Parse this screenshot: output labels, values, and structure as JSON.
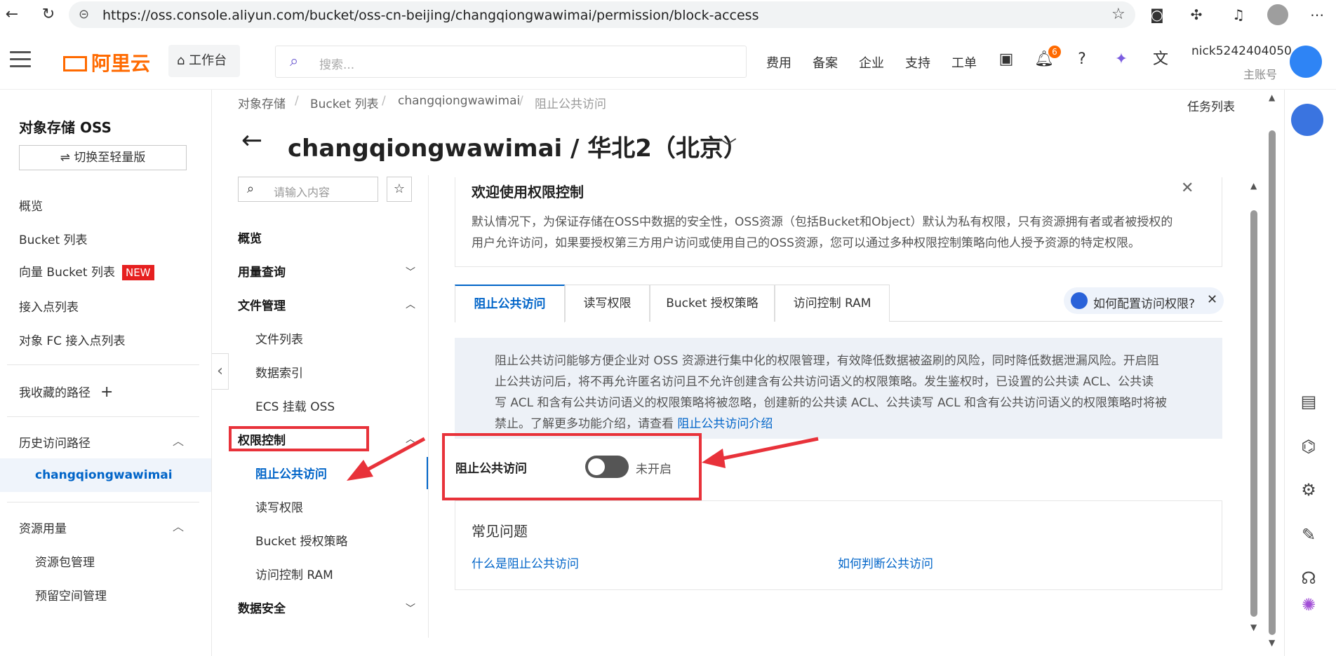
{
  "browser": {
    "url": "https://oss.console.aliyun.com/bucket/oss-cn-beijing/changqiongwawimai/permission/block-access"
  },
  "header": {
    "logo": "阿里云",
    "workbench": "工作台",
    "search_placeholder": "搜索...",
    "links": [
      "费用",
      "备案",
      "企业",
      "支持",
      "工单"
    ],
    "notification_count": "6",
    "username": "nick5242404050",
    "account_type": "主账号"
  },
  "left_nav": {
    "title": "对象存储 OSS",
    "switch_button": "⇌ 切换至轻量版",
    "items": [
      "概览",
      "Bucket 列表",
      "向量 Bucket 列表",
      "接入点列表",
      "对象 FC 接入点列表"
    ],
    "new_badge": "NEW",
    "favorites": "我收藏的路径",
    "history_title": "历史访问路径",
    "history_item": "changqiongwawimai",
    "resource_title": "资源用量",
    "resource_items": [
      "资源包管理",
      "预留空间管理"
    ]
  },
  "breadcrumb": [
    "对象存储",
    "Bucket 列表",
    "changqiongwawimai",
    "阻止公共访问"
  ],
  "task_list": "任务列表",
  "page_title": "changqiongwawimai / 华北2（北京）",
  "sub_nav": {
    "search_placeholder": "请输入内容",
    "groups": {
      "overview": "概览",
      "usage": "用量查询",
      "files": "文件管理",
      "permission": "权限控制",
      "data_security": "数据安全"
    },
    "file_items": [
      "文件列表",
      "数据索引",
      "ECS 挂载 OSS"
    ],
    "permission_items": [
      "阻止公共访问",
      "读写权限",
      "Bucket 授权策略",
      "访问控制 RAM"
    ]
  },
  "welcome": {
    "title": "欢迎使用权限控制",
    "lines": [
      "默认情况下，为保证存储在OSS中数据的安全性，OSS资源（包括Bucket和Object）默认为私有权限，只有资源拥有者或者被授权的",
      "用户允许访问，如果要授权第三方用户访问或使用自己的OSS资源，您可以通过多种权限控制策略向他人授予资源的特定权限。"
    ]
  },
  "tabs": [
    "阻止公共访问",
    "读写权限",
    "Bucket 授权策略",
    "访问控制 RAM"
  ],
  "help_pill": "如何配置访问权限?",
  "info": {
    "lines": [
      "阻止公共访问能够方便企业对 OSS 资源进行集中化的权限管理，有效降低数据被盗刷的风险，同时降低数据泄漏风险。开启阻",
      "止公共访问后，将不再允许匿名访问且不允许创建含有公共访问语义的权限策略。发生鉴权时，已设置的公共读 ACL、公共读",
      "写 ACL 和含有公共访问语义的权限策略将被忽略，创建新的公共读 ACL、公共读写 ACL 和含有公共访问语义的权限策略时将被",
      "禁止。了解更多功能介绍，请查看 "
    ],
    "link": "阻止公共访问介绍"
  },
  "block_access": {
    "label": "阻止公共访问",
    "enabled": false,
    "status": "未开启"
  },
  "faq": {
    "title": "常见问题",
    "links": [
      "什么是阻止公共访问",
      "如何判断公共访问"
    ]
  },
  "colors": {
    "brand": "#ff6a00",
    "link": "#0064c8",
    "annotation": "#e8323a"
  }
}
